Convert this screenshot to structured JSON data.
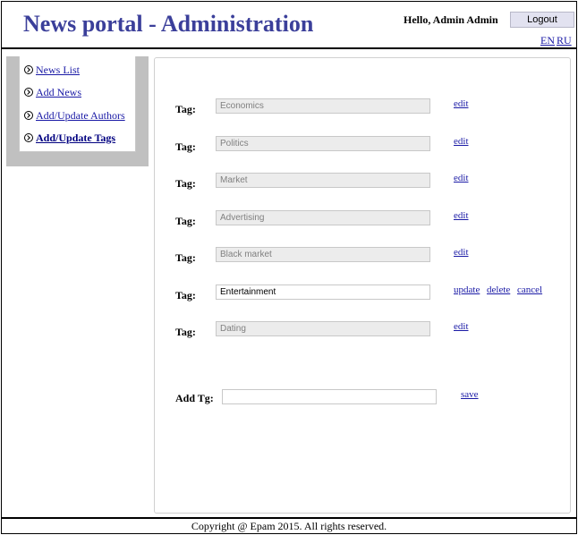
{
  "header": {
    "title": "News portal - Administration",
    "greeting": "Hello, Admin Admin",
    "logout_label": "Logout",
    "lang_en": "EN",
    "lang_ru": "RU"
  },
  "sidebar": {
    "items": [
      {
        "label": "News List",
        "active": false
      },
      {
        "label": "Add News",
        "active": false
      },
      {
        "label": "Add/Update Authors",
        "active": false
      },
      {
        "label": "Add/Update Tags",
        "active": true
      }
    ]
  },
  "tags": {
    "row_label": "Tag:",
    "edit_label": "edit",
    "update_label": "update",
    "delete_label": "delete",
    "cancel_label": "cancel",
    "items": [
      {
        "value": "Economics",
        "editing": false
      },
      {
        "value": "Politics",
        "editing": false
      },
      {
        "value": "Market",
        "editing": false
      },
      {
        "value": "Advertising",
        "editing": false
      },
      {
        "value": "Black market",
        "editing": false
      },
      {
        "value": "Entertainment",
        "editing": true
      },
      {
        "value": "Dating",
        "editing": false
      }
    ]
  },
  "add_tag": {
    "label": "Add Tg:",
    "value": "",
    "save_label": "save"
  },
  "footer": {
    "copyright": "Copyright @ Epam 2015. All rights reserved."
  },
  "colors": {
    "title": "#3b3f9a",
    "link": "#1a1aa6",
    "sidebar_frame": "#c0c0c0",
    "disabled_input": "#ececec"
  }
}
